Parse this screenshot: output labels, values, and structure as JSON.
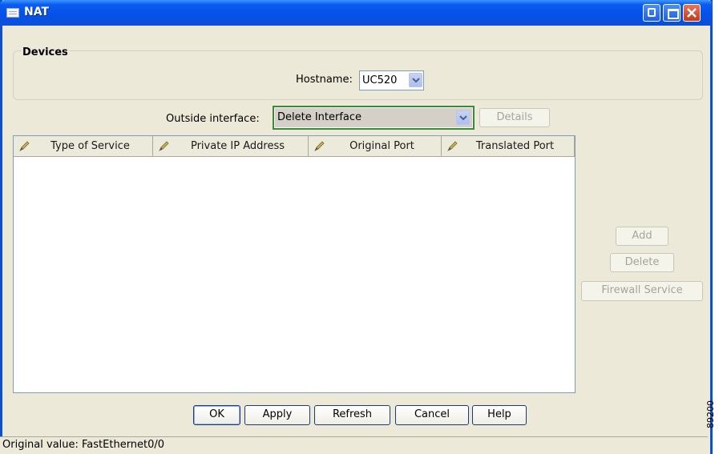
{
  "window": {
    "title": "NAT"
  },
  "devices": {
    "group_label": "Devices",
    "hostname_label": "Hostname:",
    "hostname_value": "UC520"
  },
  "outside": {
    "label": "Outside interface:",
    "value": "Delete Interface",
    "details_label": "Details"
  },
  "table": {
    "columns": [
      "Type of Service",
      "Private IP Address",
      "Original Port",
      "Translated Port"
    ],
    "rows": []
  },
  "side_buttons": {
    "add": "Add",
    "delete": "Delete",
    "firewall": "Firewall Service"
  },
  "bottom_buttons": {
    "ok": "OK",
    "apply": "Apply",
    "refresh": "Refresh",
    "cancel": "Cancel",
    "help": "Help"
  },
  "status": {
    "text": "Original value: FastEthernet0/0"
  },
  "watermark": "89200",
  "colors": {
    "title_bar": "#0a4fd6",
    "outside_combo_border": "#3a8a3a",
    "close_button": "#c3381a"
  },
  "icons": {
    "title": "window-icon",
    "minimize": "minimize-icon",
    "maximize": "maximize-icon",
    "close": "close-icon",
    "column": "pencil-icon",
    "dropdown": "chevron-down-icon"
  }
}
